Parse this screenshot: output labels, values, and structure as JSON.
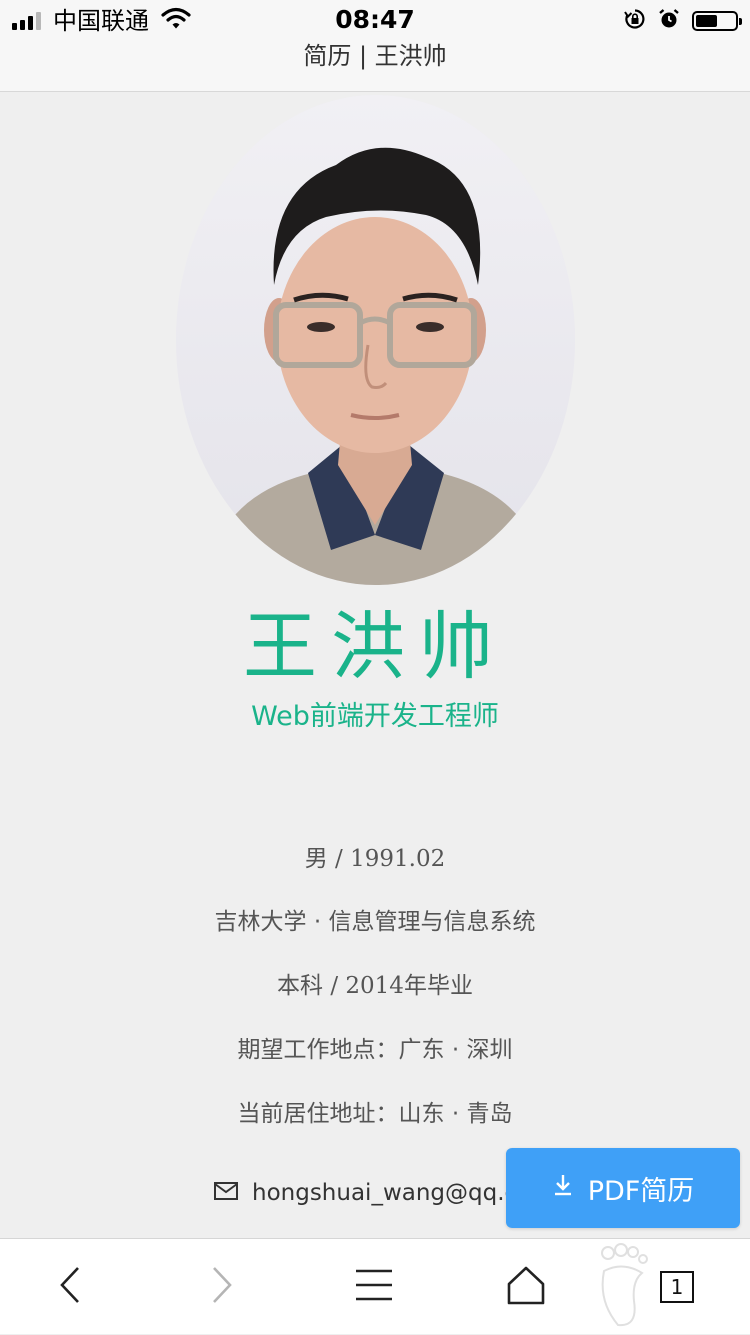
{
  "status_bar": {
    "carrier": "中国联通",
    "time": "08:47",
    "battery_level_fraction": 0.55,
    "icons": [
      "signal-icon",
      "wifi-icon",
      "rotation-lock-icon",
      "alarm-icon",
      "battery-icon"
    ]
  },
  "nav": {
    "title": "简历 | 王洪帅"
  },
  "profile": {
    "photo_icon": "profile-photo",
    "name": "王洪帅",
    "role": "Web前端开发工程师"
  },
  "info": {
    "gender": "男",
    "sep": " / ",
    "birth": "1991.02",
    "university": "吉林大学 · 信息管理与信息系统",
    "degree": "本科",
    "grad_year": "2014",
    "grad_suffix": "年毕业",
    "expected_location": "期望工作地点：广东 · 深圳",
    "current_address": "当前居住地址：山东 · 青岛",
    "email": "hongshuai_wang@qq.co"
  },
  "actions": {
    "pdf_label": "PDF简历",
    "pdf_icon": "download-icon"
  },
  "toolbar": {
    "tabs_count": "1",
    "icons": [
      "back-icon",
      "forward-icon",
      "menu-icon",
      "home-icon",
      "footprint-icon",
      "tabs-icon"
    ]
  },
  "colors": {
    "accent": "#1ab38a",
    "button": "#3fa0f7",
    "background": "#efefef"
  }
}
